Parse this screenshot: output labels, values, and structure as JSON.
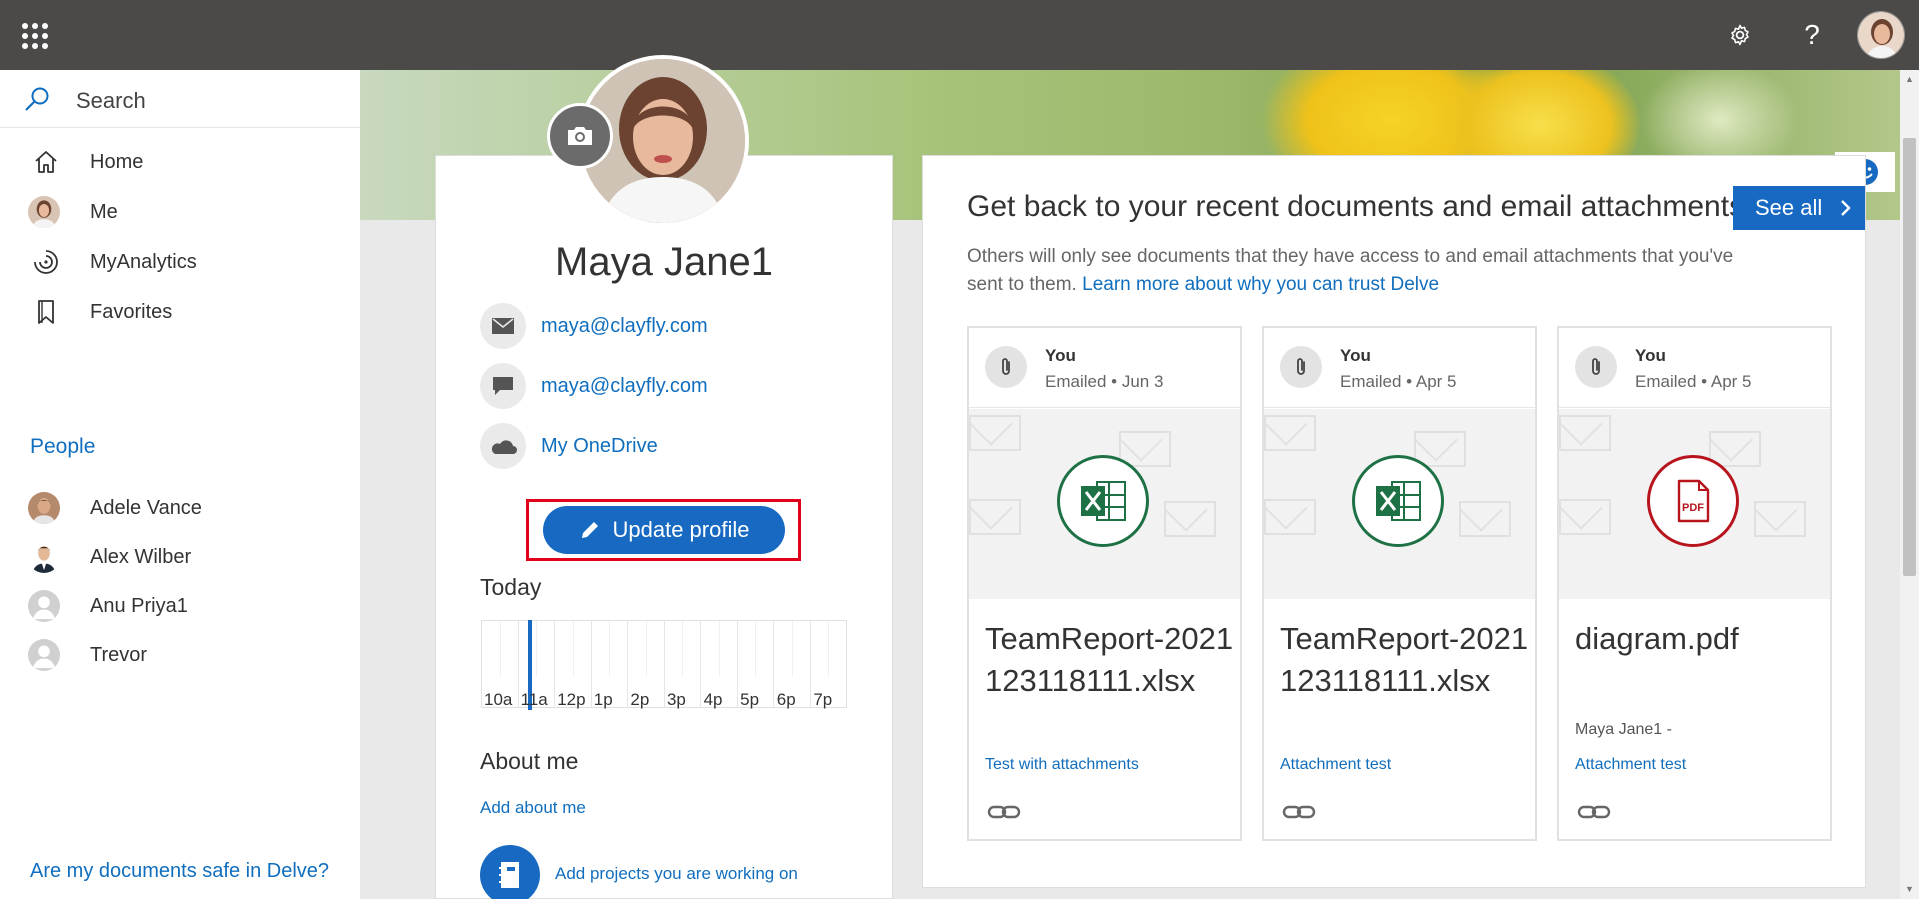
{
  "topbar": {
    "settings_icon": "gear-icon",
    "help_label": "?"
  },
  "sidebar": {
    "search_label": "Search",
    "nav": [
      {
        "label": "Home",
        "icon": "home-icon"
      },
      {
        "label": "Me",
        "icon": "avatar"
      },
      {
        "label": "MyAnalytics",
        "icon": "analytics-icon"
      },
      {
        "label": "Favorites",
        "icon": "bookmark-icon"
      }
    ],
    "people_heading": "People",
    "people": [
      {
        "name": "Adele Vance"
      },
      {
        "name": "Alex Wilber"
      },
      {
        "name": "Anu Priya1"
      },
      {
        "name": "Trevor"
      }
    ],
    "safe_link": "Are my documents safe in Delve?"
  },
  "profile": {
    "name": "Maya Jane1",
    "email": "maya@clayfly.com",
    "chat": "maya@clayfly.com",
    "onedrive": "My OneDrive",
    "update_button": "Update profile",
    "today_label": "Today",
    "timeline": [
      "10a",
      "11a",
      "12p",
      "1p",
      "2p",
      "3p",
      "4p",
      "5p",
      "6p",
      "7p"
    ],
    "about_title": "About me",
    "about_link": "Add about me",
    "projects_link": "Add projects you are working on"
  },
  "docs": {
    "title": "Get back to your recent documents and email attachments",
    "see_all": "See all",
    "subtitle": "Others will only see documents that they have access to and email attachments that you've sent to them.",
    "trust_link": "Learn more about why you can trust Delve",
    "items": [
      {
        "who": "You",
        "when": "Emailed • Jun 3",
        "type": "Excel",
        "name": "TeamReport-2021123118111.xlsx",
        "author": "",
        "link": "Test with attachments",
        "color": "#1e7145"
      },
      {
        "who": "You",
        "when": "Emailed • Apr 5",
        "type": "Excel",
        "name": "TeamReport-2021123118111.xlsx",
        "author": "",
        "link": "Attachment test",
        "color": "#1e7145"
      },
      {
        "who": "You",
        "when": "Emailed • Apr 5",
        "type": "PDF",
        "name": "diagram.pdf",
        "author": "Maya Jane1 -",
        "link": "Attachment test",
        "color": "#b7141e"
      }
    ]
  },
  "colors": {
    "accent": "#1769c2",
    "link": "#106ebe",
    "topbar": "#4b4a48",
    "highlight": "#e3001b"
  }
}
